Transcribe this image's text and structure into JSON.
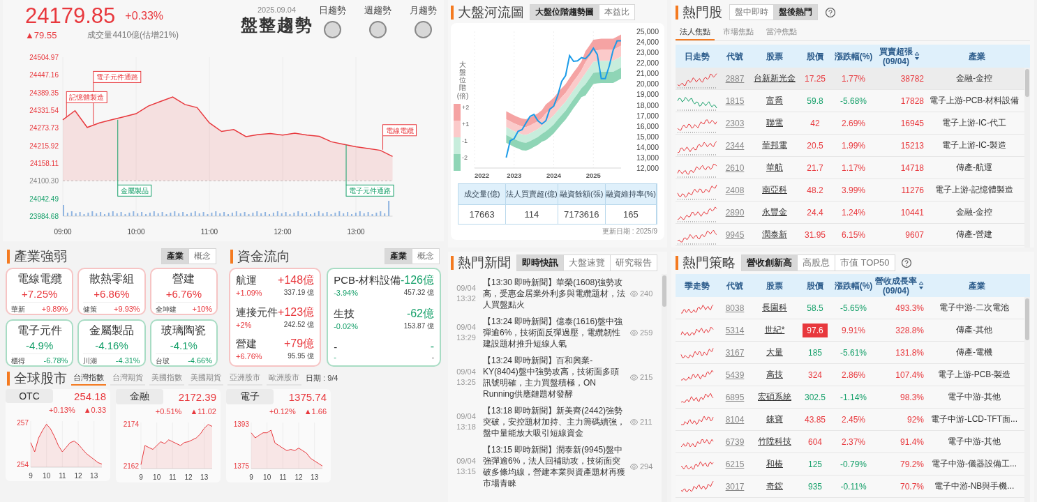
{
  "index_header": {
    "value": "24179.85",
    "change_pct": "+0.33%",
    "change": "▲79.55",
    "volume": "成交量4410億(估增21%)",
    "date": "2025.09.04",
    "trend": "盤整趨勢",
    "trend_signals": [
      {
        "label": "日趨勢"
      },
      {
        "label": "週趨勢"
      },
      {
        "label": "月趨勢"
      }
    ]
  },
  "intraday": {
    "chart_data": {
      "type": "area",
      "x": [
        9,
        9.167,
        9.333,
        9.5,
        9.667,
        9.833,
        10,
        10.167,
        10.333,
        10.5,
        10.667,
        10.833,
        11,
        11.167,
        11.333,
        11.5,
        11.667,
        11.833,
        12,
        12.167,
        12.333,
        12.5,
        12.667,
        12.833,
        13,
        13.167,
        13.333,
        13.5
      ],
      "xlim": [
        9,
        13.5
      ],
      "xticks": [
        {
          "value": 9,
          "label": "09:00"
        },
        {
          "value": 10,
          "label": "10:00"
        },
        {
          "value": 11,
          "label": "11:00"
        },
        {
          "value": 12,
          "label": "12:00"
        },
        {
          "value": 13,
          "label": "13:00"
        }
      ],
      "ylim": [
        23984.68,
        24504.97
      ],
      "yticks": [
        {
          "value": 24504.97,
          "label": "24504.97"
        },
        {
          "value": 24447.16,
          "label": "24447.16"
        },
        {
          "value": 24389.35,
          "label": "24389.35"
        },
        {
          "value": 24331.54,
          "label": "24331.54"
        },
        {
          "value": 24273.73,
          "label": "24273.73"
        },
        {
          "value": 24215.92,
          "label": "24215.92"
        },
        {
          "value": 24158.11,
          "label": "24158.11"
        },
        {
          "value": 24100.3,
          "label": "24100.30"
        },
        {
          "value": 24042.49,
          "label": "24042.49"
        },
        {
          "value": 23984.68,
          "label": "23984.68"
        }
      ],
      "series": [
        {
          "color": "#e8383d",
          "values": [
            24300,
            24330,
            24275,
            24290,
            24300,
            24310,
            24320,
            24345,
            24360,
            24375,
            24350,
            24340,
            24290,
            24262,
            24268,
            24245,
            24252,
            24255,
            24250,
            24256,
            24250,
            24246,
            24228,
            24220,
            24212,
            24206,
            24200,
            24180
          ]
        }
      ],
      "grid": true,
      "ref_lines": [
        {
          "axis": "y",
          "value": 24100.3
        }
      ],
      "annotations": [
        {
          "text": "記憶體製造",
          "x": 9.05,
          "y": 24310
        },
        {
          "text": "電子元件通路",
          "x": 9.417,
          "y": 24285
        },
        {
          "text": "金屬製品",
          "x": 9.75,
          "y": 24300
        },
        {
          "text": "電子元件通路",
          "x": 12.867,
          "y": 24218
        },
        {
          "text": "電線電纜",
          "x": 13.367,
          "y": 24202
        }
      ]
    },
    "callouts": [
      {
        "kind": "up"
      },
      {
        "kind": "up"
      },
      {
        "kind": "down"
      },
      {
        "kind": "down"
      },
      {
        "kind": "up"
      }
    ]
  },
  "industry_strength": {
    "title": "產業強弱",
    "toggle": [
      {
        "label": "產業",
        "selected": true
      },
      {
        "label": "概念",
        "selected": false
      }
    ],
    "cards": [
      {
        "name": "電線電纜",
        "pct": "+7.25%",
        "stock": "華新",
        "stock_pct": "+9.89%",
        "kind": "up"
      },
      {
        "name": "散熱零組",
        "pct": "+6.86%",
        "stock": "健策",
        "stock_pct": "+9.93%",
        "kind": "up"
      },
      {
        "name": "營建",
        "pct": "+6.76%",
        "stock": "全坤建",
        "stock_pct": "+10%",
        "kind": "up"
      },
      {
        "name": "電子元件",
        "pct": "-4.9%",
        "stock": "櫃得",
        "stock_pct": "-6.78%",
        "kind": "down"
      },
      {
        "name": "金屬製品",
        "pct": "-4.16%",
        "stock": "川湖",
        "stock_pct": "-4.31%",
        "kind": "down"
      },
      {
        "name": "玻璃陶瓷",
        "pct": "-4.1%",
        "stock": "台玻",
        "stock_pct": "-4.66%",
        "kind": "down"
      }
    ]
  },
  "fund_flow": {
    "title": "資金流向",
    "toggle": [
      {
        "label": "產業",
        "selected": true
      },
      {
        "label": "概念",
        "selected": false
      }
    ],
    "cards": [
      {
        "kind": "up",
        "rows": [
          {
            "name": "航運",
            "amount": "+148億",
            "pct": "+1.09%",
            "total": "337.19 億"
          },
          {
            "name": "連接元件",
            "amount": "+123億",
            "pct": "+2%",
            "total": "242.52 億"
          },
          {
            "name": "營建",
            "amount": "+79億",
            "pct": "+6.76%",
            "total": "95.95 億"
          }
        ]
      },
      {
        "kind": "down",
        "rows": [
          {
            "name": "PCB-材料設備",
            "amount": "-126億",
            "pct": "-3.94%",
            "total": "457.32 億"
          },
          {
            "name": "生技",
            "amount": "-62億",
            "pct": "-0.02%",
            "total": "153.87 億"
          },
          {
            "name": "-",
            "amount": "-",
            "pct": "-",
            "total": "-"
          }
        ]
      }
    ]
  },
  "global_markets": {
    "title": "全球股市",
    "tabs": [
      {
        "label": "台灣指數",
        "selected": true
      },
      {
        "label": "台灣期貨",
        "selected": false
      },
      {
        "label": "美國指數",
        "selected": false
      },
      {
        "label": "美國期貨",
        "selected": false
      },
      {
        "label": "亞洲股市",
        "selected": false
      },
      {
        "label": "歐洲股市",
        "selected": false
      }
    ],
    "date": "日期 : 9/4",
    "cards": [
      {
        "name": "OTC",
        "value": "254.18",
        "change_pct": "+0.13%",
        "change": "▲0.33",
        "chart_data": {
          "type": "area",
          "x": [
            9,
            9.25,
            9.5,
            9.75,
            10,
            10.25,
            10.5,
            10.75,
            11,
            11.25,
            11.5,
            11.75,
            12,
            12.25,
            12.5,
            12.75,
            13,
            13.25,
            13.5
          ],
          "grid": true,
          "xlim": [
            9,
            13.5
          ],
          "ylim": [
            254,
            257
          ],
          "xticks": [
            9,
            10,
            11,
            12,
            13
          ],
          "yticks": [
            {
              "value": 257,
              "label": "257"
            },
            {
              "value": 254,
              "label": "254"
            }
          ],
          "series": [
            {
              "color": "#e8383d",
              "values": [
                255.6,
                255.0,
                255.9,
                256.4,
                256.8,
                256.5,
                256.0,
                255.4,
                255.0,
                255.3,
                255.6,
                255.7,
                255.5,
                255.2,
                254.9,
                254.7,
                254.5,
                254.3,
                254.2
              ]
            }
          ]
        }
      },
      {
        "name": "金融",
        "value": "2172.39",
        "change_pct": "+0.51%",
        "change": "▲11.02",
        "chart_data": {
          "type": "area",
          "x": [
            9,
            9.25,
            9.5,
            9.75,
            10,
            10.25,
            10.5,
            10.75,
            11,
            11.25,
            11.5,
            11.75,
            12,
            12.25,
            12.5,
            12.75,
            13,
            13.25,
            13.5
          ],
          "grid": true,
          "xlim": [
            9,
            13.5
          ],
          "ylim": [
            2162,
            2174
          ],
          "xticks": [
            9,
            10,
            11,
            12,
            13
          ],
          "yticks": [
            {
              "value": 2174,
              "label": "2174"
            },
            {
              "value": 2162,
              "label": "2162"
            }
          ],
          "series": [
            {
              "color": "#e8383d",
              "values": [
                2163,
                2168,
                2167.5,
                2167,
                2168,
                2169,
                2168.5,
                2169.5,
                2169,
                2168.5,
                2168,
                2168.8,
                2169,
                2169.5,
                2170,
                2171,
                2172.5,
                2173.5,
                2173
              ]
            }
          ]
        }
      },
      {
        "name": "電子",
        "value": "1375.74",
        "change_pct": "+0.12%",
        "change": "▲1.66",
        "chart_data": {
          "type": "area",
          "x": [
            9,
            9.25,
            9.5,
            9.75,
            10,
            10.25,
            10.5,
            10.75,
            11,
            11.25,
            11.5,
            11.75,
            12,
            12.25,
            12.5,
            12.75,
            13,
            13.25,
            13.5
          ],
          "grid": true,
          "xlim": [
            9,
            13.5
          ],
          "ylim": [
            1375,
            1393
          ],
          "xticks": [
            9,
            10,
            11,
            12,
            13
          ],
          "yticks": [
            {
              "value": 1393,
              "label": "1393"
            },
            {
              "value": 1375,
              "label": "1375"
            }
          ],
          "series": [
            {
              "color": "#e8383d",
              "values": [
                1389,
                1387,
                1388,
                1389,
                1389,
                1390,
                1385,
                1384,
                1383,
                1382,
                1382.5,
                1382,
                1383,
                1382,
                1381,
                1379,
                1378,
                1377,
                1376
              ]
            }
          ]
        }
      }
    ]
  },
  "river": {
    "title": "大盤河流圖",
    "tabs": [
      {
        "label": "大盤位階趨勢圖",
        "selected": true
      },
      {
        "label": "本益比",
        "selected": false
      }
    ],
    "legend_title": "大盤位階",
    "legend_unit": "(倍)",
    "chart_data": {
      "type": "line",
      "x": [
        2022.8,
        2022.9,
        2023.0,
        2023.1,
        2023.2,
        2023.3,
        2023.4,
        2023.5,
        2023.6,
        2023.7,
        2023.8,
        2023.9,
        2024.0,
        2024.1,
        2024.2,
        2024.3,
        2024.4,
        2024.5,
        2024.6,
        2024.7,
        2024.8,
        2024.9,
        2025.0,
        2025.1,
        2025.2,
        2025.3,
        2025.4,
        2025.5,
        2025.6,
        2025.7
      ],
      "grid": true,
      "xlim": [
        2022,
        2025.7
      ],
      "ylim": [
        12000,
        25000
      ],
      "xticks": [
        {
          "value": 2022,
          "label": "2022"
        },
        {
          "value": 2023,
          "label": "2023"
        },
        {
          "value": 2024,
          "label": "2024"
        },
        {
          "value": 2025,
          "label": "2025"
        }
      ],
      "yticks": [
        {
          "value": 25000,
          "label": "25,000"
        },
        {
          "value": 24000,
          "label": "24,000"
        },
        {
          "value": 23000,
          "label": "23,000"
        },
        {
          "value": 22000,
          "label": "22,000"
        },
        {
          "value": 21000,
          "label": "21,000"
        },
        {
          "value": 20000,
          "label": "20,000"
        },
        {
          "value": 19000,
          "label": "19,000"
        },
        {
          "value": 18000,
          "label": "18,000"
        },
        {
          "value": 17000,
          "label": "17,000"
        },
        {
          "value": 16000,
          "label": "16,000"
        },
        {
          "value": 15000,
          "label": "15,000"
        },
        {
          "value": 14000,
          "label": "14,000"
        },
        {
          "value": 13000,
          "label": "13,000"
        },
        {
          "value": 12000,
          "label": "12,000"
        }
      ],
      "series": [
        {
          "name": "+2",
          "type": "area",
          "color": "#f5a3a3",
          "values": [
            17400,
            17200,
            17000,
            16850,
            16700,
            16650,
            16800,
            17000,
            17200,
            17500,
            18050,
            18350,
            18700,
            19150,
            19600,
            20000,
            20550,
            21100,
            21600,
            22150,
            23100,
            23650,
            24200,
            24250,
            24300,
            24300,
            24300,
            24300,
            24500,
            24700
          ]
        },
        {
          "name": "+1",
          "type": "area",
          "color": "#fbcaca",
          "values": [
            16650,
            16450,
            16250,
            16100,
            15950,
            15900,
            16050,
            16250,
            16450,
            16750,
            17200,
            17500,
            17850,
            18300,
            18750,
            19150,
            19700,
            20250,
            20750,
            21300,
            22050,
            22600,
            23150,
            23200,
            23250,
            23250,
            23250,
            23250,
            23450,
            23650
          ]
        },
        {
          "name": "-1",
          "type": "area",
          "color": "#c7eddc",
          "values": [
            15900,
            15700,
            15500,
            15350,
            15200,
            15150,
            15300,
            15500,
            15700,
            16000,
            16350,
            16650,
            17000,
            17450,
            17900,
            18300,
            18850,
            19400,
            19900,
            20450,
            21000,
            21550,
            22100,
            22150,
            22200,
            22200,
            22200,
            22200,
            22400,
            22600
          ]
        },
        {
          "name": "-2",
          "type": "area",
          "color": "#8fd5b6",
          "values": [
            15150,
            14950,
            14750,
            14600,
            14450,
            14400,
            14550,
            14750,
            14950,
            15250,
            15500,
            15800,
            16150,
            16600,
            17050,
            17450,
            18000,
            18550,
            19050,
            19600,
            19950,
            20500,
            21050,
            21100,
            21150,
            21150,
            21150,
            21150,
            21350,
            21550
          ]
        },
        {
          "type": "line",
          "color": "#1a9be8",
          "values": [
            13000,
            14600,
            14800,
            15500,
            15650,
            16300,
            16900,
            17100,
            16500,
            16200,
            16500,
            17600,
            17890,
            18900,
            20250,
            20800,
            22700,
            22150,
            22200,
            22500,
            22400,
            22800,
            23400,
            22800,
            20500,
            20500,
            21700,
            23200,
            24100,
            24100
          ]
        }
      ]
    },
    "stats": {
      "columns": [
        "成交量(億)",
        "法人買賣超(億)",
        "融資餘額(張)",
        "融資維持率(%)"
      ],
      "values": [
        "17663",
        "114",
        "7173616",
        "165"
      ]
    },
    "updated": "更新日期 : 2025/9"
  },
  "news": {
    "title": "熱門新聞",
    "tabs": [
      {
        "label": "即時快訊",
        "selected": true
      },
      {
        "label": "大盤速覽",
        "selected": false
      },
      {
        "label": "研究報告",
        "selected": false
      }
    ],
    "items": [
      {
        "date": "09/04",
        "time": "13:32",
        "text": "【13:30 即時新聞】華榮(1608)強勢攻高，受惠金居業外利多與電纜題材，法人買盤點火",
        "views": "240"
      },
      {
        "date": "09/04",
        "time": "13:29",
        "text": "【13:24 即時新聞】億泰(1616)盤中強彈逾6%，技術面反彈過壓，電纜韌性建設題材推升短線人氣",
        "views": "259"
      },
      {
        "date": "09/04",
        "time": "13:25",
        "text": "【13:24 即時新聞】百和興業-KY(8404)盤中強勢攻高，技術面多頭訊號明確，主力買盤積極，ON Running供應鏈題材發酵",
        "views": "215"
      },
      {
        "date": "09/04",
        "time": "13:18",
        "text": "【13:18 即時新聞】新美齊(2442)強勢突破，安控題材加持、主力籌碼續強，盤中量能放大吸引短線資金",
        "views": "211"
      },
      {
        "date": "09/04",
        "time": "13:15",
        "text": "【13:15 即時新聞】潤泰新(9945)盤中強彈逾6%，法人回補助攻，技術面突破多條均線，營建本業與資產題材再獲市場青睞",
        "views": "294"
      }
    ]
  },
  "hot_stocks": {
    "title": "熱門股",
    "tabs": [
      {
        "label": "盤中即時",
        "selected": false
      },
      {
        "label": "盤後熱門",
        "selected": true
      }
    ],
    "subtabs": [
      {
        "label": "法人焦點",
        "selected": true
      },
      {
        "label": "市場焦點",
        "selected": false
      },
      {
        "label": "當沖焦點",
        "selected": false
      }
    ],
    "columns": [
      {
        "label": "日走勢",
        "sorted": false
      },
      {
        "label": "代號",
        "sorted": false
      },
      {
        "label": "股票",
        "sorted": false
      },
      {
        "label": "股價",
        "sorted": false
      },
      {
        "label": "漲跌幅(%)",
        "sorted": false
      },
      {
        "label": "買賣超張",
        "sub": "(09/04)",
        "sorted": true
      },
      {
        "label": "產業",
        "sorted": false
      }
    ],
    "rows": [
      {
        "code": "2887",
        "name": "台新新光金",
        "price": "17.25",
        "pct": "1.77%",
        "net": "38782",
        "industry": "金融-金控",
        "kind": "up",
        "selected": true
      },
      {
        "code": "1815",
        "name": "富喬",
        "price": "59.8",
        "pct": "-5.68%",
        "net": "17828",
        "industry": "電子上游-PCB-材料設備",
        "kind": "down",
        "selected": false
      },
      {
        "code": "2303",
        "name": "聯電",
        "price": "42",
        "pct": "2.69%",
        "net": "16945",
        "industry": "電子上游-IC-代工",
        "kind": "up",
        "selected": false
      },
      {
        "code": "2344",
        "name": "華邦電",
        "price": "20.5",
        "pct": "1.99%",
        "net": "15213",
        "industry": "電子上游-IC-製造",
        "kind": "up",
        "selected": false
      },
      {
        "code": "2610",
        "name": "華航",
        "price": "21.7",
        "pct": "1.17%",
        "net": "14718",
        "industry": "傳產-航運",
        "kind": "up",
        "selected": false
      },
      {
        "code": "2408",
        "name": "南亞科",
        "price": "48.2",
        "pct": "3.99%",
        "net": "11276",
        "industry": "電子上游-記憶體製造",
        "kind": "up",
        "selected": false
      },
      {
        "code": "2890",
        "name": "永豐金",
        "price": "24.4",
        "pct": "1.24%",
        "net": "10441",
        "industry": "金融-金控",
        "kind": "up",
        "selected": false
      },
      {
        "code": "9945",
        "name": "潤泰新",
        "price": "31.95",
        "pct": "6.15%",
        "net": "9607",
        "industry": "傳產-營建",
        "kind": "up",
        "selected": false
      }
    ]
  },
  "strategies": {
    "title": "熱門策略",
    "tabs": [
      {
        "label": "營收創新高",
        "selected": true
      },
      {
        "label": "高股息",
        "selected": false
      },
      {
        "label": "市值 TOP50",
        "selected": false
      }
    ],
    "columns": [
      {
        "label": "季走勢",
        "sorted": false
      },
      {
        "label": "代號",
        "sorted": false
      },
      {
        "label": "股票",
        "sorted": false
      },
      {
        "label": "股價",
        "sorted": false
      },
      {
        "label": "漲跌幅(%)",
        "sorted": false
      },
      {
        "label": "營收成長率",
        "sub": "(09/04)",
        "sorted": true
      },
      {
        "label": "產業",
        "sorted": false
      }
    ],
    "rows": [
      {
        "code": "8038",
        "name": "長園科",
        "price": "58.5",
        "pct": "-5.65%",
        "growth": "493.3%",
        "industry": "電子中游-二次電池",
        "kind": "down",
        "limit_up": false
      },
      {
        "code": "5314",
        "name": "世紀*",
        "price": "97.6",
        "pct": "9.91%",
        "growth": "328.8%",
        "industry": "傳產-其他",
        "kind": "up",
        "limit_up": true
      },
      {
        "code": "3167",
        "name": "大量",
        "price": "185",
        "pct": "-5.61%",
        "growth": "131.8%",
        "industry": "傳產-電機",
        "kind": "down",
        "limit_up": false
      },
      {
        "code": "5439",
        "name": "高技",
        "price": "324",
        "pct": "2.86%",
        "growth": "107.4%",
        "industry": "電子上游-PCB-製造",
        "kind": "up",
        "limit_up": false
      },
      {
        "code": "6895",
        "name": "宏碩系統",
        "price": "302.5",
        "pct": "-1.14%",
        "growth": "98.3%",
        "industry": "電子中游-其他",
        "kind": "down",
        "limit_up": false
      },
      {
        "code": "8104",
        "name": "錸寶",
        "price": "43.85",
        "pct": "2.45%",
        "growth": "92%",
        "industry": "電子中游-LCD-TFT面...",
        "kind": "up",
        "limit_up": false
      },
      {
        "code": "6739",
        "name": "竹陞科技",
        "price": "604",
        "pct": "2.37%",
        "growth": "91.4%",
        "industry": "電子中游-其他",
        "kind": "up",
        "limit_up": false
      },
      {
        "code": "6215",
        "name": "和椿",
        "price": "125",
        "pct": "-0.79%",
        "growth": "79.2%",
        "industry": "電子中游-儀器設備工...",
        "kind": "down",
        "limit_up": false
      },
      {
        "code": "3017",
        "name": "奇鋐",
        "price": "935",
        "pct": "-0.11%",
        "growth": "70.7%",
        "industry": "電子中游-NB與手機...",
        "kind": "down",
        "limit_up": false
      }
    ]
  }
}
